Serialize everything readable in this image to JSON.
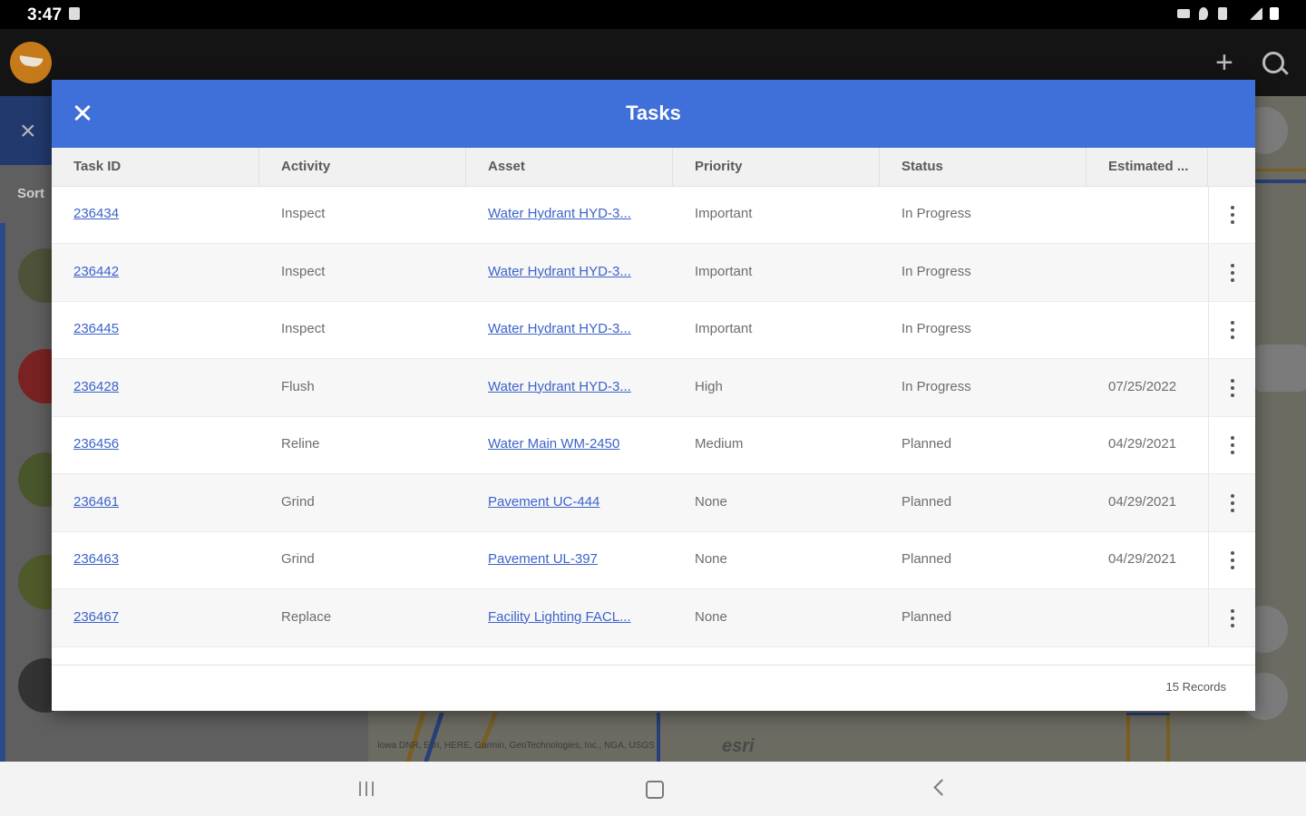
{
  "status_bar": {
    "time": "3:47"
  },
  "background": {
    "sort_label": "Sort"
  },
  "map": {
    "attribution": "Iowa DNR, Esri, HERE, Garmin, GeoTechnologies, Inc., NGA, USGS",
    "logo": "esri"
  },
  "modal": {
    "title": "Tasks",
    "columns": [
      "Task ID",
      "Activity",
      "Asset",
      "Priority",
      "Status",
      "Estimated ..."
    ],
    "rows": [
      {
        "task_id": "236434",
        "activity": "Inspect",
        "asset": "Water Hydrant HYD-3...",
        "priority": "Important",
        "status": "In Progress",
        "estimated": ""
      },
      {
        "task_id": "236442",
        "activity": "Inspect",
        "asset": "Water Hydrant HYD-3...",
        "priority": "Important",
        "status": "In Progress",
        "estimated": ""
      },
      {
        "task_id": "236445",
        "activity": "Inspect",
        "asset": "Water Hydrant HYD-3...",
        "priority": "Important",
        "status": "In Progress",
        "estimated": ""
      },
      {
        "task_id": "236428",
        "activity": "Flush",
        "asset": "Water Hydrant HYD-3...",
        "priority": "High",
        "status": "In Progress",
        "estimated": "07/25/2022"
      },
      {
        "task_id": "236456",
        "activity": "Reline",
        "asset": "Water Main WM-2450",
        "priority": "Medium",
        "status": "Planned",
        "estimated": "04/29/2021"
      },
      {
        "task_id": "236461",
        "activity": "Grind",
        "asset": "Pavement UC-444",
        "priority": "None",
        "status": "Planned",
        "estimated": "04/29/2021"
      },
      {
        "task_id": "236463",
        "activity": "Grind",
        "asset": "Pavement UL-397",
        "priority": "None",
        "status": "Planned",
        "estimated": "04/29/2021"
      },
      {
        "task_id": "236467",
        "activity": "Replace",
        "asset": "Facility Lighting FACL...",
        "priority": "None",
        "status": "Planned",
        "estimated": ""
      }
    ],
    "records_text": "15 Records"
  },
  "icons": {
    "close": "close-icon",
    "row_menu": "more-vert-icon",
    "add": "plus-icon",
    "search": "search-icon",
    "layers": "layers-icon",
    "nav_recent": "recent-apps-icon",
    "nav_home": "home-icon",
    "nav_back": "back-icon"
  },
  "colors": {
    "header_blue": "#3f6fd8",
    "link_blue": "#3d63c9"
  }
}
